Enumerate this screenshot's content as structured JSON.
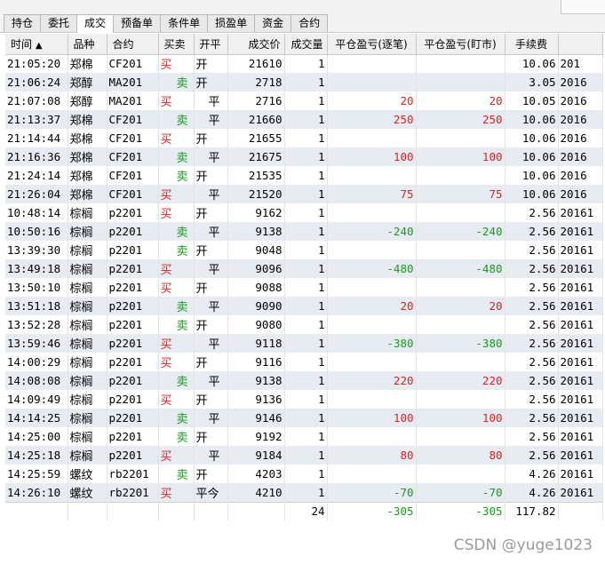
{
  "tabs": [
    {
      "label": "持仓",
      "active": false
    },
    {
      "label": "委托",
      "active": false
    },
    {
      "label": "成交",
      "active": true
    },
    {
      "label": "预备单",
      "active": false
    },
    {
      "label": "条件单",
      "active": false
    },
    {
      "label": "损盈单",
      "active": false
    },
    {
      "label": "资金",
      "active": false
    },
    {
      "label": "合约",
      "active": false
    }
  ],
  "columns": [
    "时间",
    "品种",
    "合约",
    "买卖",
    "开平",
    "成交价",
    "成交量",
    "平仓盈亏(逐笔)",
    "平仓盈亏(盯市)",
    "手续费",
    ""
  ],
  "sort_indicator": "▲",
  "rows": [
    {
      "time": "21:05:20",
      "product": "郑棉",
      "contract": "CF201",
      "side": "买",
      "oc": "开",
      "price": "21610",
      "qty": "1",
      "pnl_trade": "",
      "pnl_mark": "",
      "fee": "10.06",
      "date": "201"
    },
    {
      "time": "21:06:24",
      "product": "郑醇",
      "contract": "MA201",
      "side": "卖",
      "oc": "开",
      "price": "2718",
      "qty": "1",
      "pnl_trade": "",
      "pnl_mark": "",
      "fee": "3.05",
      "date": "2016"
    },
    {
      "time": "21:07:08",
      "product": "郑醇",
      "contract": "MA201",
      "side": "买",
      "oc": "平",
      "price": "2716",
      "qty": "1",
      "pnl_trade": "20",
      "pnl_mark": "20",
      "fee": "10.05",
      "date": "2016"
    },
    {
      "time": "21:13:37",
      "product": "郑棉",
      "contract": "CF201",
      "side": "卖",
      "oc": "平",
      "price": "21660",
      "qty": "1",
      "pnl_trade": "250",
      "pnl_mark": "250",
      "fee": "10.06",
      "date": "2016"
    },
    {
      "time": "21:14:44",
      "product": "郑棉",
      "contract": "CF201",
      "side": "买",
      "oc": "开",
      "price": "21655",
      "qty": "1",
      "pnl_trade": "",
      "pnl_mark": "",
      "fee": "10.06",
      "date": "2016"
    },
    {
      "time": "21:16:36",
      "product": "郑棉",
      "contract": "CF201",
      "side": "卖",
      "oc": "平",
      "price": "21675",
      "qty": "1",
      "pnl_trade": "100",
      "pnl_mark": "100",
      "fee": "10.06",
      "date": "2016"
    },
    {
      "time": "21:24:14",
      "product": "郑棉",
      "contract": "CF201",
      "side": "卖",
      "oc": "开",
      "price": "21535",
      "qty": "1",
      "pnl_trade": "",
      "pnl_mark": "",
      "fee": "10.06",
      "date": "2016"
    },
    {
      "time": "21:26:04",
      "product": "郑棉",
      "contract": "CF201",
      "side": "买",
      "oc": "平",
      "price": "21520",
      "qty": "1",
      "pnl_trade": "75",
      "pnl_mark": "75",
      "fee": "10.06",
      "date": "2016"
    },
    {
      "time": "10:48:14",
      "product": "棕榈",
      "contract": "p2201",
      "side": "买",
      "oc": "开",
      "price": "9162",
      "qty": "1",
      "pnl_trade": "",
      "pnl_mark": "",
      "fee": "2.56",
      "date": "20161"
    },
    {
      "time": "10:50:16",
      "product": "棕榈",
      "contract": "p2201",
      "side": "卖",
      "oc": "平",
      "price": "9138",
      "qty": "1",
      "pnl_trade": "-240",
      "pnl_mark": "-240",
      "fee": "2.56",
      "date": "20161"
    },
    {
      "time": "13:39:30",
      "product": "棕榈",
      "contract": "p2201",
      "side": "卖",
      "oc": "开",
      "price": "9048",
      "qty": "1",
      "pnl_trade": "",
      "pnl_mark": "",
      "fee": "2.56",
      "date": "20161"
    },
    {
      "time": "13:49:18",
      "product": "棕榈",
      "contract": "p2201",
      "side": "买",
      "oc": "平",
      "price": "9096",
      "qty": "1",
      "pnl_trade": "-480",
      "pnl_mark": "-480",
      "fee": "2.56",
      "date": "20161"
    },
    {
      "time": "13:50:10",
      "product": "棕榈",
      "contract": "p2201",
      "side": "买",
      "oc": "开",
      "price": "9088",
      "qty": "1",
      "pnl_trade": "",
      "pnl_mark": "",
      "fee": "2.56",
      "date": "20161"
    },
    {
      "time": "13:51:18",
      "product": "棕榈",
      "contract": "p2201",
      "side": "卖",
      "oc": "平",
      "price": "9090",
      "qty": "1",
      "pnl_trade": "20",
      "pnl_mark": "20",
      "fee": "2.56",
      "date": "20161"
    },
    {
      "time": "13:52:28",
      "product": "棕榈",
      "contract": "p2201",
      "side": "卖",
      "oc": "开",
      "price": "9080",
      "qty": "1",
      "pnl_trade": "",
      "pnl_mark": "",
      "fee": "2.56",
      "date": "20161"
    },
    {
      "time": "13:59:46",
      "product": "棕榈",
      "contract": "p2201",
      "side": "买",
      "oc": "平",
      "price": "9118",
      "qty": "1",
      "pnl_trade": "-380",
      "pnl_mark": "-380",
      "fee": "2.56",
      "date": "20161"
    },
    {
      "time": "14:00:29",
      "product": "棕榈",
      "contract": "p2201",
      "side": "买",
      "oc": "开",
      "price": "9116",
      "qty": "1",
      "pnl_trade": "",
      "pnl_mark": "",
      "fee": "2.56",
      "date": "20161"
    },
    {
      "time": "14:08:08",
      "product": "棕榈",
      "contract": "p2201",
      "side": "卖",
      "oc": "平",
      "price": "9138",
      "qty": "1",
      "pnl_trade": "220",
      "pnl_mark": "220",
      "fee": "2.56",
      "date": "20161"
    },
    {
      "time": "14:09:49",
      "product": "棕榈",
      "contract": "p2201",
      "side": "买",
      "oc": "开",
      "price": "9136",
      "qty": "1",
      "pnl_trade": "",
      "pnl_mark": "",
      "fee": "2.56",
      "date": "20161"
    },
    {
      "time": "14:14:25",
      "product": "棕榈",
      "contract": "p2201",
      "side": "卖",
      "oc": "平",
      "price": "9146",
      "qty": "1",
      "pnl_trade": "100",
      "pnl_mark": "100",
      "fee": "2.56",
      "date": "20161"
    },
    {
      "time": "14:25:00",
      "product": "棕榈",
      "contract": "p2201",
      "side": "卖",
      "oc": "开",
      "price": "9192",
      "qty": "1",
      "pnl_trade": "",
      "pnl_mark": "",
      "fee": "2.56",
      "date": "20161"
    },
    {
      "time": "14:25:18",
      "product": "棕榈",
      "contract": "p2201",
      "side": "买",
      "oc": "平",
      "price": "9184",
      "qty": "1",
      "pnl_trade": "80",
      "pnl_mark": "80",
      "fee": "2.56",
      "date": "20161"
    },
    {
      "time": "14:25:59",
      "product": "螺纹",
      "contract": "rb2201",
      "side": "卖",
      "oc": "开",
      "price": "4203",
      "qty": "1",
      "pnl_trade": "",
      "pnl_mark": "",
      "fee": "4.26",
      "date": "20161"
    },
    {
      "time": "14:26:10",
      "product": "螺纹",
      "contract": "rb2201",
      "side": "买",
      "oc": "平今",
      "price": "4210",
      "qty": "1",
      "pnl_trade": "-70",
      "pnl_mark": "-70",
      "fee": "4.26",
      "date": "20161"
    }
  ],
  "totals": {
    "qty": "24",
    "pnl_trade": "-305",
    "pnl_mark": "-305",
    "fee": "117.82"
  },
  "watermark": "CSDN @yuge1023"
}
